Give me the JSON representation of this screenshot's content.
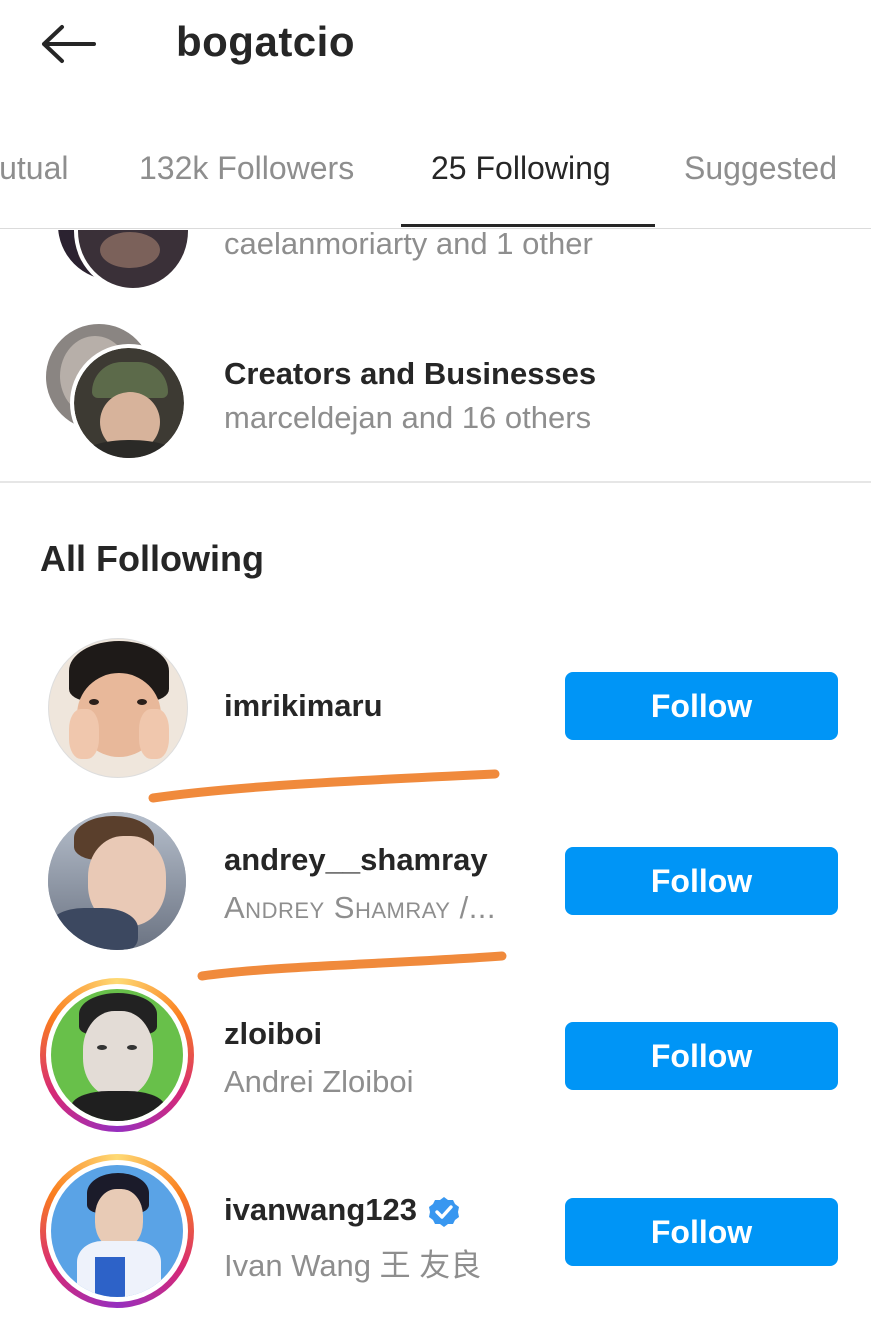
{
  "header": {
    "title": "bogatcio"
  },
  "tabs": [
    {
      "label": "lutual",
      "active": false
    },
    {
      "label": "132k Followers",
      "active": false
    },
    {
      "label": "25 Following",
      "active": true
    },
    {
      "label": "Suggested",
      "active": false
    }
  ],
  "categories": [
    {
      "title": "",
      "subtitle": "caelanmoriarty and 1 other"
    },
    {
      "title": "Creators and Businesses",
      "subtitle": "marceldejan and 16 others"
    }
  ],
  "section": {
    "title": "All Following"
  },
  "users": [
    {
      "username": "imrikimaru",
      "fullname": "",
      "button": "Follow",
      "verified": false,
      "story_ring": false
    },
    {
      "username": "andrey__shamray",
      "fullname": "Andrey Shamray /...",
      "button": "Follow",
      "verified": false,
      "story_ring": false
    },
    {
      "username": "zloiboi",
      "fullname": "Andrei Zloiboi",
      "button": "Follow",
      "verified": false,
      "story_ring": true
    },
    {
      "username": "ivanwang123",
      "fullname": "Ivan Wang 王 友良",
      "button": "Follow",
      "verified": true,
      "story_ring": true
    }
  ],
  "colors": {
    "accent": "#0095f6",
    "strike": "#f08a3c",
    "text": "#262626",
    "muted": "#8e8e8e"
  },
  "icons": {
    "back": "arrow-left-icon",
    "verified": "verified-badge-icon"
  }
}
